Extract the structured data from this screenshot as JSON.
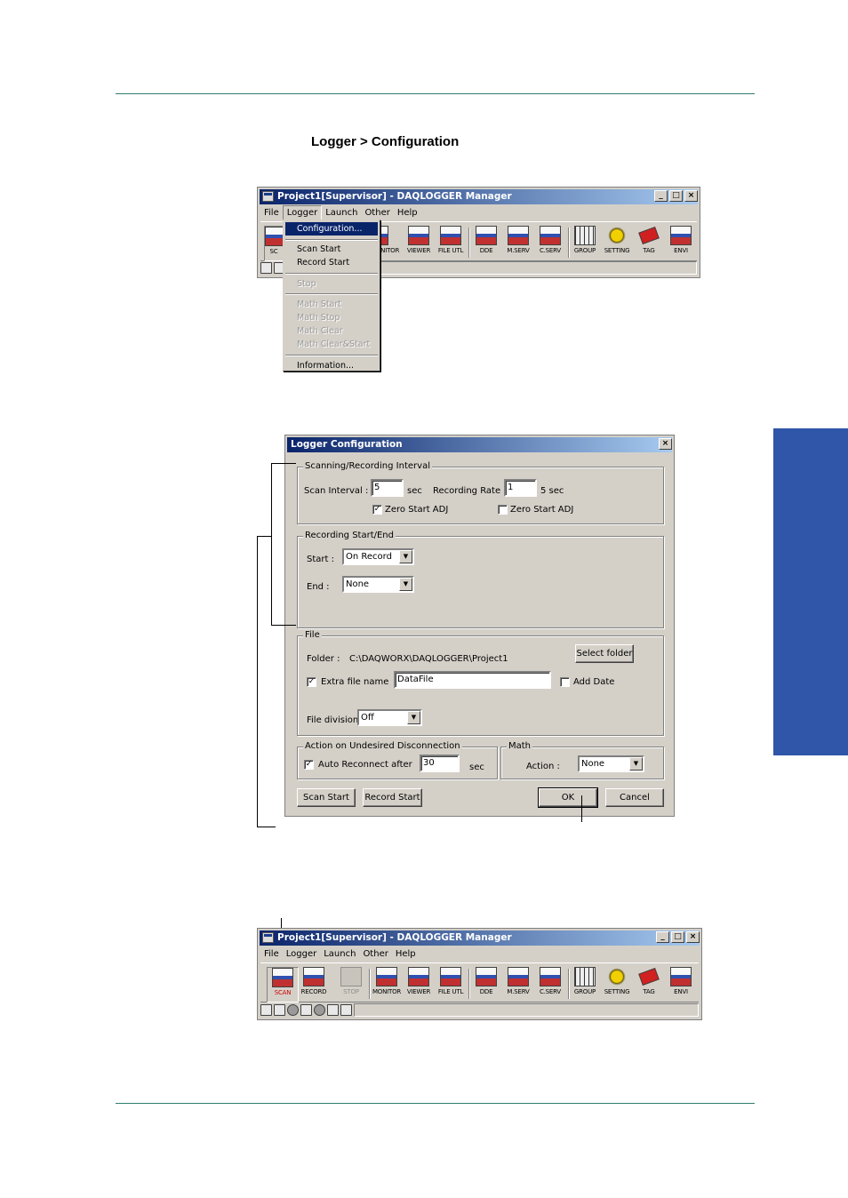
{
  "page": {
    "heading": "Logger > Configuration"
  },
  "win1": {
    "title": "Project1[Supervisor] - DAQLOGGER Manager",
    "menu": [
      "File",
      "Logger",
      "Launch",
      "Other",
      "Help"
    ],
    "tools_visible": [
      {
        "label": "SC"
      },
      {
        "label": "ONITOR"
      },
      {
        "label": "VIEWER"
      },
      {
        "label": "FILE UTL"
      },
      {
        "label": "DDE"
      },
      {
        "label": "M.SERV"
      },
      {
        "label": "C.SERV"
      },
      {
        "label": "GROUP"
      },
      {
        "label": "SETTING"
      },
      {
        "label": "TAG"
      },
      {
        "label": "ENVI"
      }
    ]
  },
  "logger_menu": {
    "items": [
      "Configuration...",
      "Scan Start",
      "Record Start",
      "Stop",
      "Math Start",
      "Math Stop",
      "Math Clear",
      "Math Clear&Start",
      "Information..."
    ]
  },
  "dialog": {
    "title": "Logger Configuration",
    "close": "×",
    "scan_group": {
      "legend": "Scanning/Recording Interval",
      "scan_interval_label": "Scan Interval :",
      "scan_interval_value": "5",
      "scan_unit": "sec",
      "rec_rate_label": "Recording Rate :",
      "rec_rate_value": "1",
      "rec_rate_unit": "5 sec",
      "zero_start_1": "Zero Start ADJ",
      "zero_start_1_checked": true,
      "zero_start_2": "Zero Start ADJ",
      "zero_start_2_checked": false
    },
    "rec_group": {
      "legend": "Recording Start/End",
      "start_label": "Start :",
      "start_value": "On Record",
      "end_label": "End :",
      "end_value": "None"
    },
    "file_group": {
      "legend": "File",
      "folder_label": "Folder :",
      "folder_value": "C:\\DAQWORX\\DAQLOGGER\\Project1",
      "select_folder": "Select folder",
      "extra_file_label": "Extra file name",
      "extra_file_checked": true,
      "extra_file_value": "DataFile",
      "add_date": "Add Date",
      "add_date_checked": false,
      "file_division_label": "File division :",
      "file_division_value": "Off"
    },
    "disc_group": {
      "legend": "Action on Undesired Disconnection",
      "auto_reconnect": "Auto Reconnect after",
      "auto_reconnect_checked": true,
      "value": "30",
      "unit": "sec"
    },
    "math_group": {
      "legend": "Math",
      "action_label": "Action :",
      "action_value": "None"
    },
    "buttons": {
      "scan_start": "Scan Start",
      "record_start": "Record Start",
      "ok": "OK",
      "cancel": "Cancel"
    }
  },
  "win2": {
    "title": "Project1[Supervisor] - DAQLOGGER Manager",
    "menu": [
      "File",
      "Logger",
      "Launch",
      "Other",
      "Help"
    ],
    "tools": [
      "SCAN",
      "RECORD",
      "STOP",
      "MONITOR",
      "VIEWER",
      "FILE UTL",
      "DDE",
      "M.SERV",
      "C.SERV",
      "GROUP",
      "SETTING",
      "TAG",
      "ENVI"
    ]
  },
  "window_buttons": [
    "_",
    "□",
    "×"
  ]
}
